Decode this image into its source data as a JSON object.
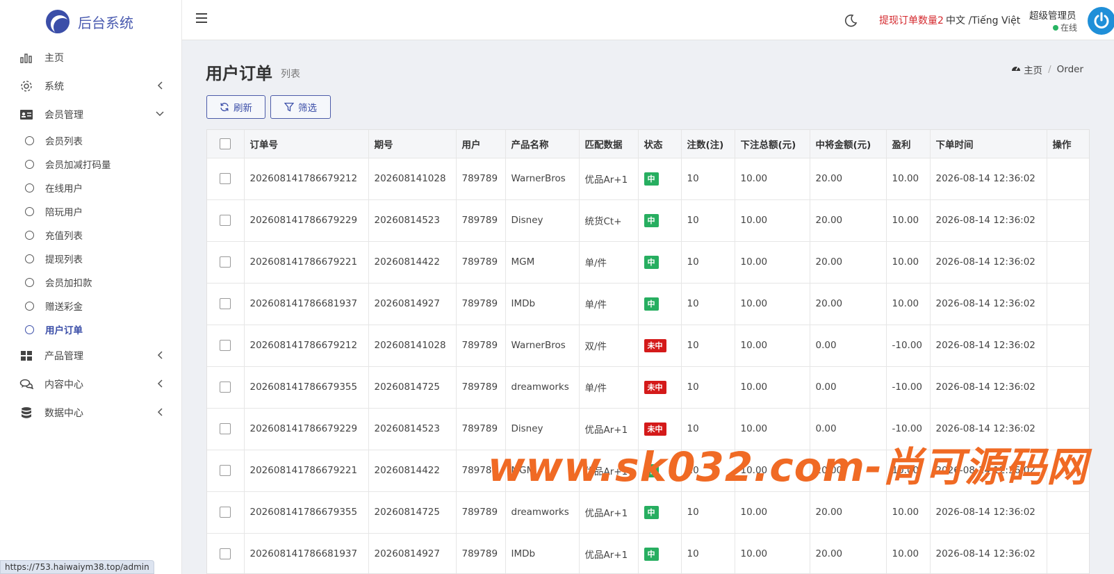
{
  "app": {
    "title": "后台系统"
  },
  "statusbar_url": "https://753.haiwaiym38.top/admin",
  "sidebar": {
    "items": [
      {
        "label": "主页"
      },
      {
        "label": "系统"
      },
      {
        "label": "会员管理"
      },
      {
        "label": "产品管理"
      },
      {
        "label": "内容中心"
      },
      {
        "label": "数据中心"
      }
    ],
    "member_sub": [
      {
        "label": "会员列表"
      },
      {
        "label": "会员加减打码量"
      },
      {
        "label": "在线用户"
      },
      {
        "label": "陪玩用户"
      },
      {
        "label": "充值列表"
      },
      {
        "label": "提现列表"
      },
      {
        "label": "会员加扣款"
      },
      {
        "label": "赠送彩金"
      },
      {
        "label": "用户订单"
      }
    ]
  },
  "topbar": {
    "withdraw_notice": "提现订单数量2",
    "language": "中文 /Tiếng Việt",
    "user_name": "超级管理员",
    "user_status": "在线"
  },
  "page": {
    "title": "用户订单",
    "subtitle": "列表",
    "breadcrumb_home": "主页",
    "breadcrumb_current": "Order"
  },
  "toolbar": {
    "refresh_label": "刷新",
    "filter_label": "筛选"
  },
  "table": {
    "headers": [
      "订单号",
      "期号",
      "用户",
      "产品名称",
      "匹配数据",
      "状态",
      "注数(注)",
      "下注总额(元)",
      "中将金额(元)",
      "盈利",
      "下单时间",
      "操作"
    ],
    "rows": [
      [
        "202608141786679212",
        "202608141028",
        "789789",
        "WarnerBros",
        "优品Ar+1",
        "中",
        "10",
        "10.00",
        "20.00",
        "10.00",
        "2026-08-14 12:36:02",
        ""
      ],
      [
        "202608141786679229",
        "20260814523",
        "789789",
        "Disney",
        "统货Ct+",
        "中",
        "10",
        "10.00",
        "20.00",
        "10.00",
        "2026-08-14 12:36:02",
        ""
      ],
      [
        "202608141786679221",
        "20260814422",
        "789789",
        "MGM",
        "单/件",
        "中",
        "10",
        "10.00",
        "20.00",
        "10.00",
        "2026-08-14 12:36:02",
        ""
      ],
      [
        "202608141786681937",
        "20260814927",
        "789789",
        "IMDb",
        "单/件",
        "中",
        "10",
        "10.00",
        "20.00",
        "10.00",
        "2026-08-14 12:36:02",
        ""
      ],
      [
        "202608141786679212",
        "202608141028",
        "789789",
        "WarnerBros",
        "双/件",
        "未中",
        "10",
        "10.00",
        "0.00",
        "-10.00",
        "2026-08-14 12:36:02",
        ""
      ],
      [
        "202608141786679355",
        "20260814725",
        "789789",
        "dreamworks",
        "单/件",
        "未中",
        "10",
        "10.00",
        "0.00",
        "-10.00",
        "2026-08-14 12:36:02",
        ""
      ],
      [
        "202608141786679229",
        "20260814523",
        "789789",
        "Disney",
        "优品Ar+1",
        "未中",
        "10",
        "10.00",
        "0.00",
        "-10.00",
        "2026-08-14 12:36:02",
        ""
      ],
      [
        "202608141786679221",
        "20260814422",
        "789789",
        "MGM",
        "优品Ar+1",
        "中",
        "10",
        "10.00",
        "20.00",
        "10.00",
        "2026-08-14 12:36:02",
        ""
      ],
      [
        "202608141786679355",
        "20260814725",
        "789789",
        "dreamworks",
        "优品Ar+1",
        "中",
        "10",
        "10.00",
        "20.00",
        "10.00",
        "2026-08-14 12:36:02",
        ""
      ],
      [
        "202608141786681937",
        "20260814927",
        "789789",
        "IMDb",
        "优品Ar+1",
        "中",
        "10",
        "10.00",
        "20.00",
        "10.00",
        "2026-08-14 12:36:02",
        ""
      ]
    ]
  },
  "watermark": "www.sk032.com-尚可源码网",
  "colors": {
    "accent": "#3b4ea8",
    "win": "#27ae60",
    "lose": "#d41a1a",
    "notice": "#d4282d",
    "watermark": "#f06a24"
  },
  "icons": {
    "home": "bar-chart-icon",
    "system": "gear-icon",
    "member": "id-card-icon",
    "product": "grid-icon",
    "content": "chat-icon",
    "data": "database-icon"
  }
}
